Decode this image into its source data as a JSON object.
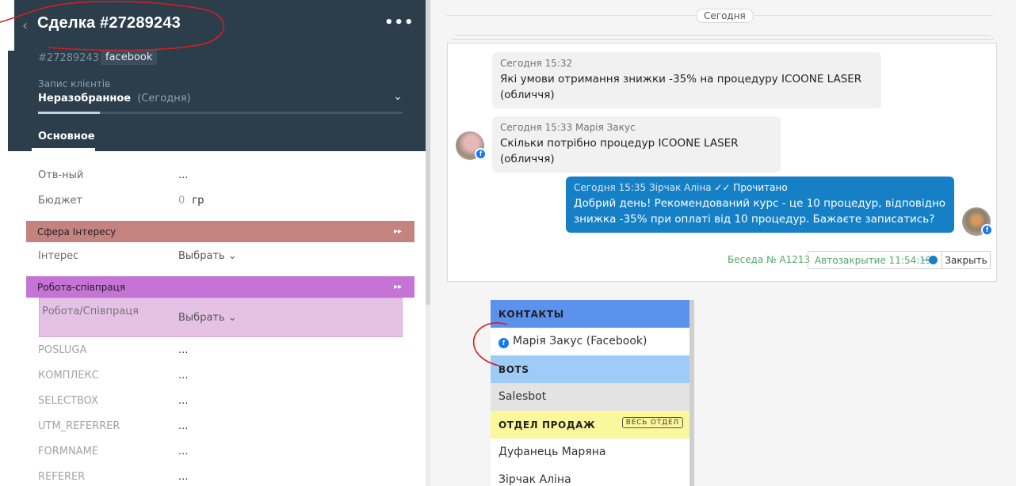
{
  "deal": {
    "title": "Сделка #27289243",
    "id": "#27289243",
    "tag": "facebook",
    "pipeline_label": "Запис клієнтів",
    "status": "Неразобранное",
    "status_date": "(Сегодня)",
    "tab_main": "Основное",
    "progress": 0.17
  },
  "fields": {
    "responsible_label": "Отв-ный",
    "responsible_value": "...",
    "budget_label": "Бюджет",
    "budget_value": "0",
    "budget_currency": "гр",
    "section_interest": "Сфера Інтересу",
    "interest_label": "Інтерес",
    "interest_value": "Выбрать",
    "section_work": "Робота-співпраця",
    "work_label": "Робота/Співпраця",
    "work_value": "Выбрать",
    "posluga_label": "POSLUGA",
    "posluga_value": "...",
    "kompleks_label": "КОМПЛЕКС",
    "kompleks_value": "...",
    "selectbox_label": "SELECTBOX",
    "selectbox_value": "...",
    "utm_label": "UTM_REFERRER",
    "utm_value": "...",
    "formname_label": "FORMNAME",
    "formname_value": "...",
    "referer_label": "REFERER",
    "referer_value": "..."
  },
  "chat": {
    "date_chip": "Сегодня",
    "messages": [
      {
        "meta": "Сегодня 15:32",
        "text_line1": "Які умови отримання знижки -35% на процедуру ICOONE LASER",
        "text_line2": "(обличчя)"
      },
      {
        "meta": "Сегодня 15:33 Марія Закус",
        "text_line1": "Скільки потрібно процедур ICOONE LASER (обличчя)"
      },
      {
        "meta": "Сегодня 15:35 Зірчак Аліна",
        "read": "✓✓ Прочитано",
        "text_line1": "Добрий день! Рекомендований курс - це 10 процедур, відповідно",
        "text_line2": "знижка -35% при оплаті від 10 процедур. Бажаєте записатись?"
      }
    ],
    "conversation": "Беседа № A1213",
    "auto_close": "Автозакрытие 11:54:19",
    "close_button": "Закрыть"
  },
  "dropdown": {
    "contacts_header": "КОНТАКТЫ",
    "contact_1": "Марія Закус (Facebook)",
    "bots_header": "BOTS",
    "bot_1": "Salesbot",
    "sales_header": "ОТДЕЛ ПРОДАЖ",
    "sales_all": "ВЕСЬ ОТДЕЛ",
    "sales_1": "Дуфанець Маряна",
    "sales_2": "Зірчак Аліна"
  },
  "icons": {
    "back": "chevron-left-icon",
    "more": "more-dots-icon",
    "status_chevron": "chevron-down-icon",
    "facebook": "facebook-icon",
    "section_toggle": "section-toggle-icon"
  },
  "colors": {
    "header_bg": "#2c3d4b",
    "interest_section": "#c58380",
    "work_section": "#c573d6",
    "work_box": "#e5c2e5",
    "outgoing_msg": "#1680c6",
    "contacts_header": "#5a92ee",
    "bots_header": "#9ecbf8",
    "sales_header": "#fbf79b",
    "autoclose_text": "#53a66a"
  }
}
